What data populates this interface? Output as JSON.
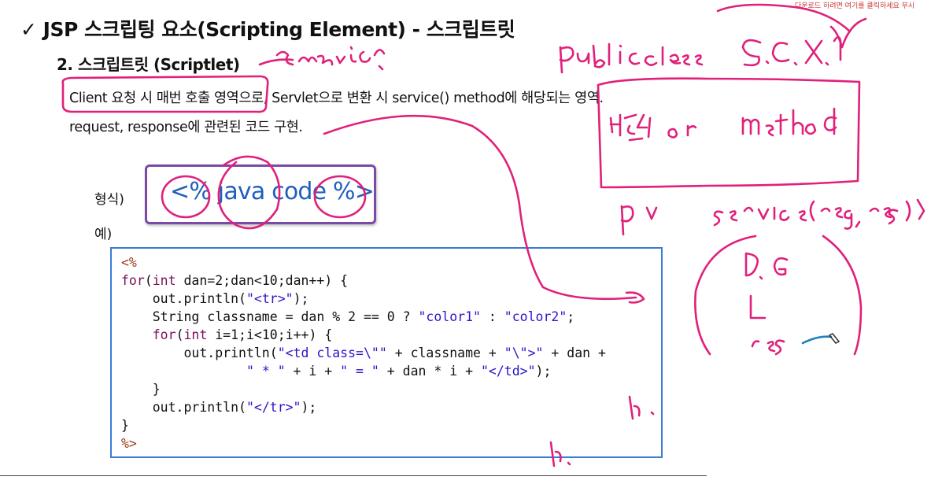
{
  "header": {
    "check": "✓",
    "title": "JSP 스크립팅 요소(Scripting Element) - 스크립트릿",
    "subtitle": "2. 스크립트릿 (Scriptlet)"
  },
  "description": {
    "line1_highlight": "Client 요청 시 매번 호출 영역",
    "line1_rest": "으로, Servlet으로 변환 시 service() method에 해당되는 영역.",
    "line2": "request, response에 관련된 코드 구현."
  },
  "labels": {
    "format": "형식)",
    "example": "예)"
  },
  "syntax": "<% java code %>",
  "code_lines": [
    [
      {
        "t": "<%",
        "c": "dl"
      }
    ],
    [
      {
        "t": "for",
        "c": "kw"
      },
      {
        "t": "(",
        "c": ""
      },
      {
        "t": "int",
        "c": "kw"
      },
      {
        "t": " dan=2;dan<10;dan++) {",
        "c": ""
      }
    ],
    [
      {
        "t": "    out.println(",
        "c": ""
      },
      {
        "t": "\"<tr>\"",
        "c": "str"
      },
      {
        "t": ");",
        "c": ""
      }
    ],
    [
      {
        "t": "    String classname = dan % 2 == 0 ? ",
        "c": ""
      },
      {
        "t": "\"color1\"",
        "c": "str"
      },
      {
        "t": " : ",
        "c": ""
      },
      {
        "t": "\"color2\"",
        "c": "str"
      },
      {
        "t": ";",
        "c": ""
      }
    ],
    [
      {
        "t": "    ",
        "c": ""
      },
      {
        "t": "for",
        "c": "kw"
      },
      {
        "t": "(",
        "c": ""
      },
      {
        "t": "int",
        "c": "kw"
      },
      {
        "t": " i=1;i<10;i++) {",
        "c": ""
      }
    ],
    [
      {
        "t": "        out.println(",
        "c": ""
      },
      {
        "t": "\"<td class=\\\"\"",
        "c": "str"
      },
      {
        "t": " + classname + ",
        "c": ""
      },
      {
        "t": "\"\\\">\"",
        "c": "str"
      },
      {
        "t": " + dan +",
        "c": ""
      }
    ],
    [
      {
        "t": "                ",
        "c": ""
      },
      {
        "t": "\" * \"",
        "c": "str"
      },
      {
        "t": " + i + ",
        "c": ""
      },
      {
        "t": "\" = \"",
        "c": "str"
      },
      {
        "t": " + dan * i + ",
        "c": ""
      },
      {
        "t": "\"</td>\"",
        "c": "str"
      },
      {
        "t": ");",
        "c": ""
      }
    ],
    [
      {
        "t": "    }",
        "c": ""
      }
    ],
    [
      {
        "t": "    out.println(",
        "c": ""
      },
      {
        "t": "\"</tr>\"",
        "c": "str"
      },
      {
        "t": ");",
        "c": ""
      }
    ],
    [
      {
        "t": "}",
        "c": ""
      }
    ],
    [
      {
        "t": "%>",
        "c": "dl"
      }
    ]
  ],
  "notice": "다운로드 하려면 여기를 클릭하세요   무시",
  "colors": {
    "ink": "#e0207a",
    "syntax_border": "#7b4aa8",
    "syntax_text": "#1f5fbf",
    "code_border": "#3a7bd5",
    "keyword": "#7a0e5a",
    "string": "#2a16c8"
  }
}
